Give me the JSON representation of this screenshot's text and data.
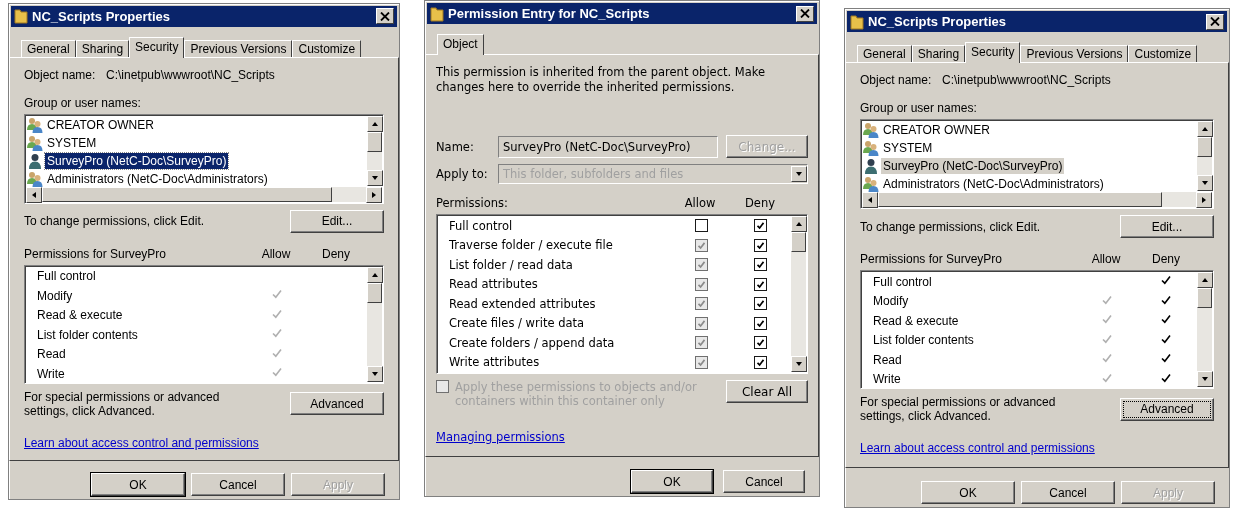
{
  "panels": [
    {
      "kind": "properties",
      "title": "NC_Scripts Properties",
      "list_focused": true,
      "tabs": [
        {
          "label": "General",
          "selected": false
        },
        {
          "label": "Sharing",
          "selected": false
        },
        {
          "label": "Security",
          "selected": true
        },
        {
          "label": "Previous Versions",
          "selected": false
        },
        {
          "label": "Customize",
          "selected": false
        }
      ],
      "object_label": "Object name:",
      "object_value": "C:\\inetpub\\wwwroot\\NC_Scripts",
      "group_label": "Group or user names:",
      "users": [
        {
          "name": "CREATOR OWNER",
          "kind": "group",
          "selected": false
        },
        {
          "name": "SYSTEM",
          "kind": "group",
          "selected": false
        },
        {
          "name": "SurveyPro (NetC-Doc\\SurveyPro)",
          "kind": "user",
          "selected": true
        },
        {
          "name": "Administrators (NetC-Doc\\Administrators)",
          "kind": "group",
          "selected": false
        }
      ],
      "edit_hint": "To change permissions, click Edit.",
      "edit_button": {
        "label": "Edit...",
        "focused": false
      },
      "permissions_label": "Permissions for SurveyPro",
      "allow_header": "Allow",
      "deny_header": "Deny",
      "permissions": [
        {
          "name": "Full control",
          "allow": false,
          "deny": false
        },
        {
          "name": "Modify",
          "allow": true,
          "allow_inherited": true,
          "deny": false
        },
        {
          "name": "Read & execute",
          "allow": true,
          "allow_inherited": true,
          "deny": false
        },
        {
          "name": "List folder contents",
          "allow": true,
          "allow_inherited": true,
          "deny": false
        },
        {
          "name": "Read",
          "allow": true,
          "allow_inherited": true,
          "deny": false
        },
        {
          "name": "Write",
          "allow": true,
          "allow_inherited": true,
          "deny": false
        }
      ],
      "advanced_hint": "For special permissions or advanced settings, click Advanced.",
      "advanced_button": {
        "label": "Advanced",
        "focused": false
      },
      "link": "Learn about access control and permissions",
      "buttons": [
        {
          "label": "OK",
          "default": true,
          "disabled": false
        },
        {
          "label": "Cancel",
          "default": false,
          "disabled": false
        },
        {
          "label": "Apply",
          "default": false,
          "disabled": true
        }
      ]
    },
    {
      "kind": "entry",
      "title": "Permission Entry for NC_Scripts",
      "tabs": [
        {
          "label": "Object",
          "selected": true
        }
      ],
      "notice": "This permission is inherited from the parent object. Make changes here to override the inherited permissions.",
      "name_label": "Name:",
      "name_value": "SurveyPro (NetC-Doc\\SurveyPro)",
      "change_button": {
        "label": "Change...",
        "disabled": true
      },
      "apply_label": "Apply to:",
      "apply_value": "This folder, subfolders and files",
      "apply_disabled": true,
      "permissions_label": "Permissions:",
      "allow_header": "Allow",
      "deny_header": "Deny",
      "permissions": [
        {
          "name": "Full control",
          "allow": false,
          "allow_disabled": false,
          "deny": true
        },
        {
          "name": "Traverse folder / execute file",
          "allow": true,
          "allow_disabled": true,
          "deny": true
        },
        {
          "name": "List folder / read data",
          "allow": true,
          "allow_disabled": true,
          "deny": true
        },
        {
          "name": "Read attributes",
          "allow": true,
          "allow_disabled": true,
          "deny": true
        },
        {
          "name": "Read extended attributes",
          "allow": true,
          "allow_disabled": true,
          "deny": true
        },
        {
          "name": "Create files / write data",
          "allow": true,
          "allow_disabled": true,
          "deny": true
        },
        {
          "name": "Create folders / append data",
          "allow": true,
          "allow_disabled": true,
          "deny": true
        },
        {
          "name": "Write attributes",
          "allow": true,
          "allow_disabled": true,
          "deny": true
        }
      ],
      "apply_only": {
        "label": "Apply these permissions to objects and/or containers within this container only",
        "checked": false,
        "disabled": true
      },
      "clear_button": "Clear All",
      "link": "Managing permissions",
      "buttons": [
        {
          "label": "OK",
          "default": true,
          "disabled": false
        },
        {
          "label": "Cancel",
          "default": false,
          "disabled": false
        }
      ]
    },
    {
      "kind": "properties",
      "title": "NC_Scripts Properties",
      "list_focused": false,
      "tabs": [
        {
          "label": "General",
          "selected": false
        },
        {
          "label": "Sharing",
          "selected": false
        },
        {
          "label": "Security",
          "selected": true
        },
        {
          "label": "Previous Versions",
          "selected": false
        },
        {
          "label": "Customize",
          "selected": false
        }
      ],
      "object_label": "Object name:",
      "object_value": "C:\\inetpub\\wwwroot\\NC_Scripts",
      "group_label": "Group or user names:",
      "users": [
        {
          "name": "CREATOR OWNER",
          "kind": "group",
          "selected": false
        },
        {
          "name": "SYSTEM",
          "kind": "group",
          "selected": false
        },
        {
          "name": "SurveyPro (NetC-Doc\\SurveyPro)",
          "kind": "user",
          "selected": true
        },
        {
          "name": "Administrators (NetC-Doc\\Administrators)",
          "kind": "group",
          "selected": false
        }
      ],
      "edit_hint": "To change permissions, click Edit.",
      "edit_button": {
        "label": "Edit...",
        "focused": false
      },
      "permissions_label": "Permissions for SurveyPro",
      "allow_header": "Allow",
      "deny_header": "Deny",
      "permissions": [
        {
          "name": "Full control",
          "allow": false,
          "deny": true
        },
        {
          "name": "Modify",
          "allow": true,
          "allow_inherited": true,
          "deny": true
        },
        {
          "name": "Read & execute",
          "allow": true,
          "allow_inherited": true,
          "deny": true
        },
        {
          "name": "List folder contents",
          "allow": true,
          "allow_inherited": true,
          "deny": true
        },
        {
          "name": "Read",
          "allow": true,
          "allow_inherited": true,
          "deny": true
        },
        {
          "name": "Write",
          "allow": true,
          "allow_inherited": true,
          "deny": true
        }
      ],
      "advanced_hint": "For special permissions or advanced settings, click Advanced.",
      "advanced_button": {
        "label": "Advanced",
        "focused": true
      },
      "link": "Learn about access control and permissions",
      "buttons": [
        {
          "label": "OK",
          "default": false,
          "disabled": false
        },
        {
          "label": "Cancel",
          "default": false,
          "disabled": false
        },
        {
          "label": "Apply",
          "default": false,
          "disabled": true
        }
      ]
    }
  ]
}
